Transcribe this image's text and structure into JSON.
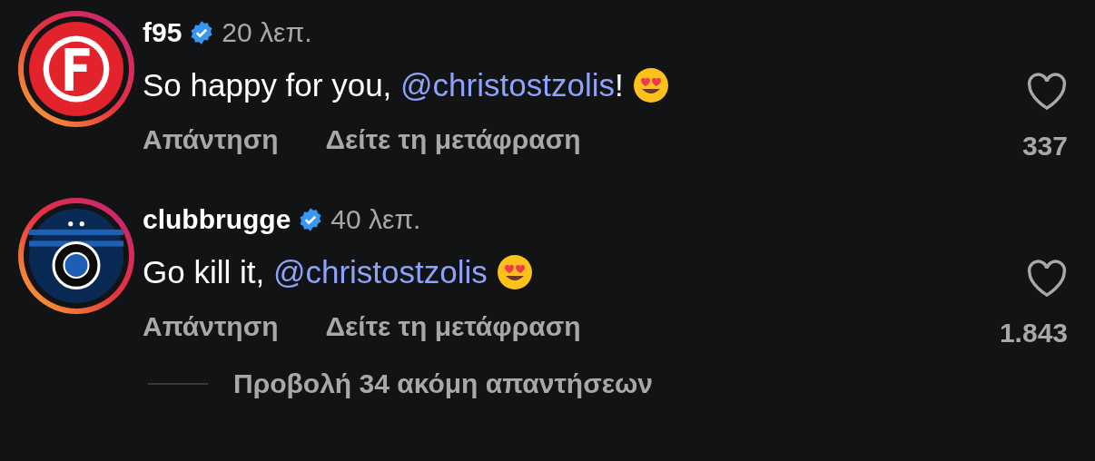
{
  "comments": [
    {
      "kind": "red-crest",
      "username": "f95",
      "verified": true,
      "time": "20 λεπ.",
      "text": "So happy for you, ",
      "mention": "@christostzolis",
      "after": "!",
      "emoji": true,
      "reply": "Απάντηση",
      "translate": "Δείτε τη μετάφραση",
      "liked": false,
      "likes": "337"
    },
    {
      "kind": "blue-crest",
      "username": "clubbrugge",
      "verified": true,
      "time": "40 λεπ.",
      "text": "Go kill it, ",
      "mention": "@christostzolis",
      "emoji": true,
      "reply": "Απάντηση",
      "translate": "Δείτε τη μετάφραση",
      "liked": false,
      "likes": "1.843"
    }
  ],
  "more_replies": "Προβολή 34 ακόμη απαντήσεων"
}
